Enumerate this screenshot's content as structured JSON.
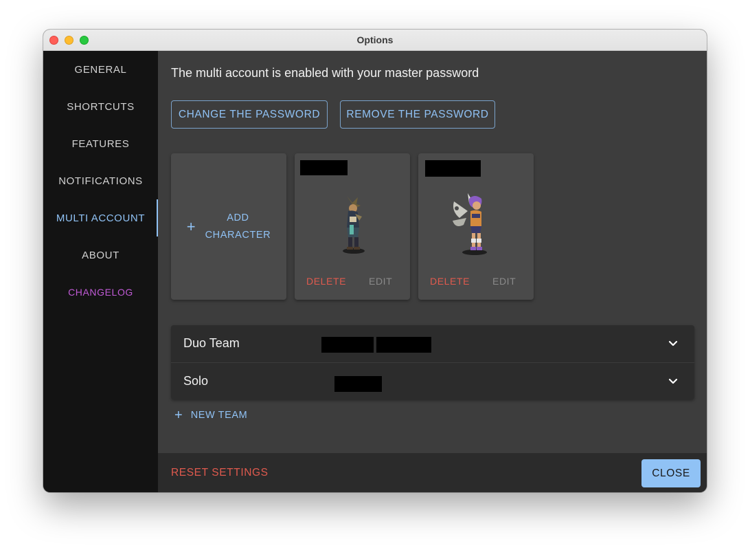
{
  "window": {
    "title": "Options"
  },
  "sidebar": {
    "items": [
      {
        "label": "GENERAL"
      },
      {
        "label": "SHORTCUTS"
      },
      {
        "label": "FEATURES"
      },
      {
        "label": "NOTIFICATIONS"
      },
      {
        "label": "MULTI ACCOUNT",
        "active": true
      },
      {
        "label": "ABOUT"
      },
      {
        "label": "CHANGELOG"
      }
    ]
  },
  "main": {
    "headline": "The multi account is enabled with your master password",
    "change_password_label": "CHANGE THE PASSWORD",
    "remove_password_label": "REMOVE THE PASSWORD",
    "add_character": {
      "plus": "+",
      "line1": "ADD",
      "line2": "CHARACTER"
    },
    "characters": [
      {
        "delete_label": "DELETE",
        "edit_label": "EDIT",
        "sprite": "winged-character-dark"
      },
      {
        "delete_label": "DELETE",
        "edit_label": "EDIT",
        "sprite": "fairy-character-purple"
      }
    ],
    "teams": [
      {
        "name": "Duo Team"
      },
      {
        "name": "Solo"
      }
    ],
    "new_team": {
      "plus": "+",
      "label": "NEW TEAM"
    }
  },
  "footer": {
    "reset_label": "RESET SETTINGS",
    "close_label": "CLOSE"
  },
  "colors": {
    "accent": "#90c2f5",
    "danger": "#e05a4e",
    "changelog": "#c05ad6",
    "sidebar_bg": "#131313",
    "content_bg": "#3d3d3d",
    "card_bg": "#4a4a4a"
  },
  "icons": {
    "add": "plus-icon",
    "expand": "chevron-down-icon"
  }
}
